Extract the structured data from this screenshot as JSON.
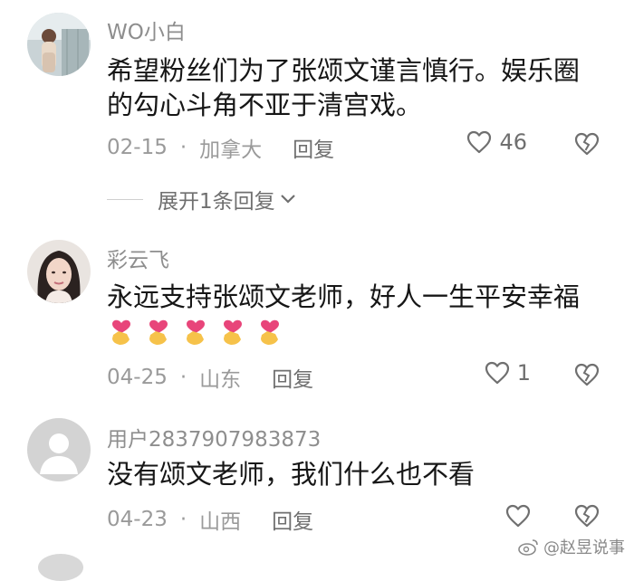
{
  "comments": [
    {
      "username": "WO小白",
      "text_lines": [
        "希望粉丝们为了张颂文谨言慎行。娱乐圈",
        "的勾心斗角不亚于清宫戏。"
      ],
      "date": "02-15",
      "location": "加拿大",
      "reply_label": "回复",
      "likes": "46",
      "expand_label": "展开1条回复"
    },
    {
      "username": "彩云飞",
      "text_lines": [
        "永远支持张颂文老师，好人一生平安幸福"
      ],
      "emoji_count": 5,
      "date": "04-25",
      "location": "山东",
      "reply_label": "回复",
      "likes": "1"
    },
    {
      "username": "用户2837907983873",
      "text_lines": [
        "没有颂文老师，我们什么也不看"
      ],
      "date": "04-23",
      "location": "山西",
      "reply_label": "回复",
      "likes": ""
    }
  ],
  "watermark": "@赵昱说事",
  "colors": {
    "username": "#8e8e8e",
    "text": "#161616",
    "meta": "#9a9a9a",
    "heart": "#e8457a",
    "hand": "#f6c24a"
  },
  "icons": [
    "heart-outline-icon",
    "broken-heart-icon",
    "chevron-down-icon",
    "finger-heart-emoji",
    "weibo-icon"
  ]
}
